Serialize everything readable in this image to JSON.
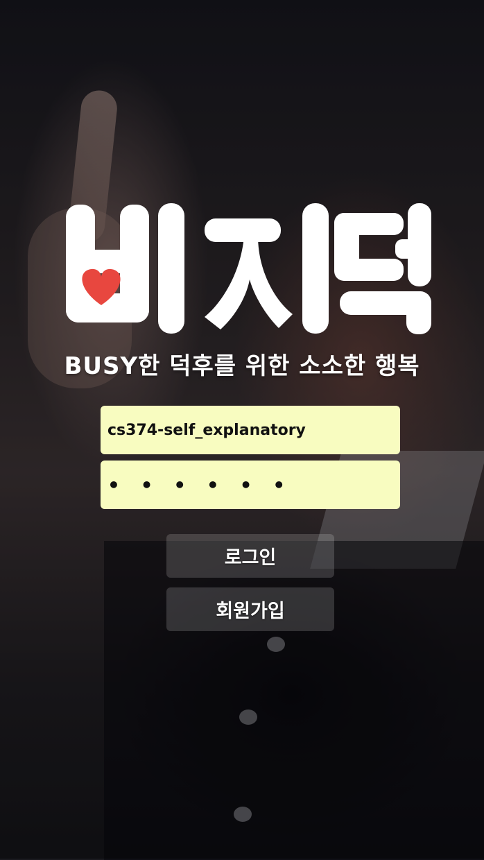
{
  "app": {
    "logo_text": "비지덕",
    "tagline": "BUSY한 덕후를 위한 소소한 행복"
  },
  "login_form": {
    "username_value": "cs374-self_explanatory",
    "password_masked": "• • • • • •"
  },
  "buttons": {
    "login_label": "로그인",
    "signup_label": "회원가입"
  },
  "colors": {
    "field_background": "#f8fcc0",
    "logo_white": "#ffffff",
    "heart_red": "#e8473f"
  }
}
